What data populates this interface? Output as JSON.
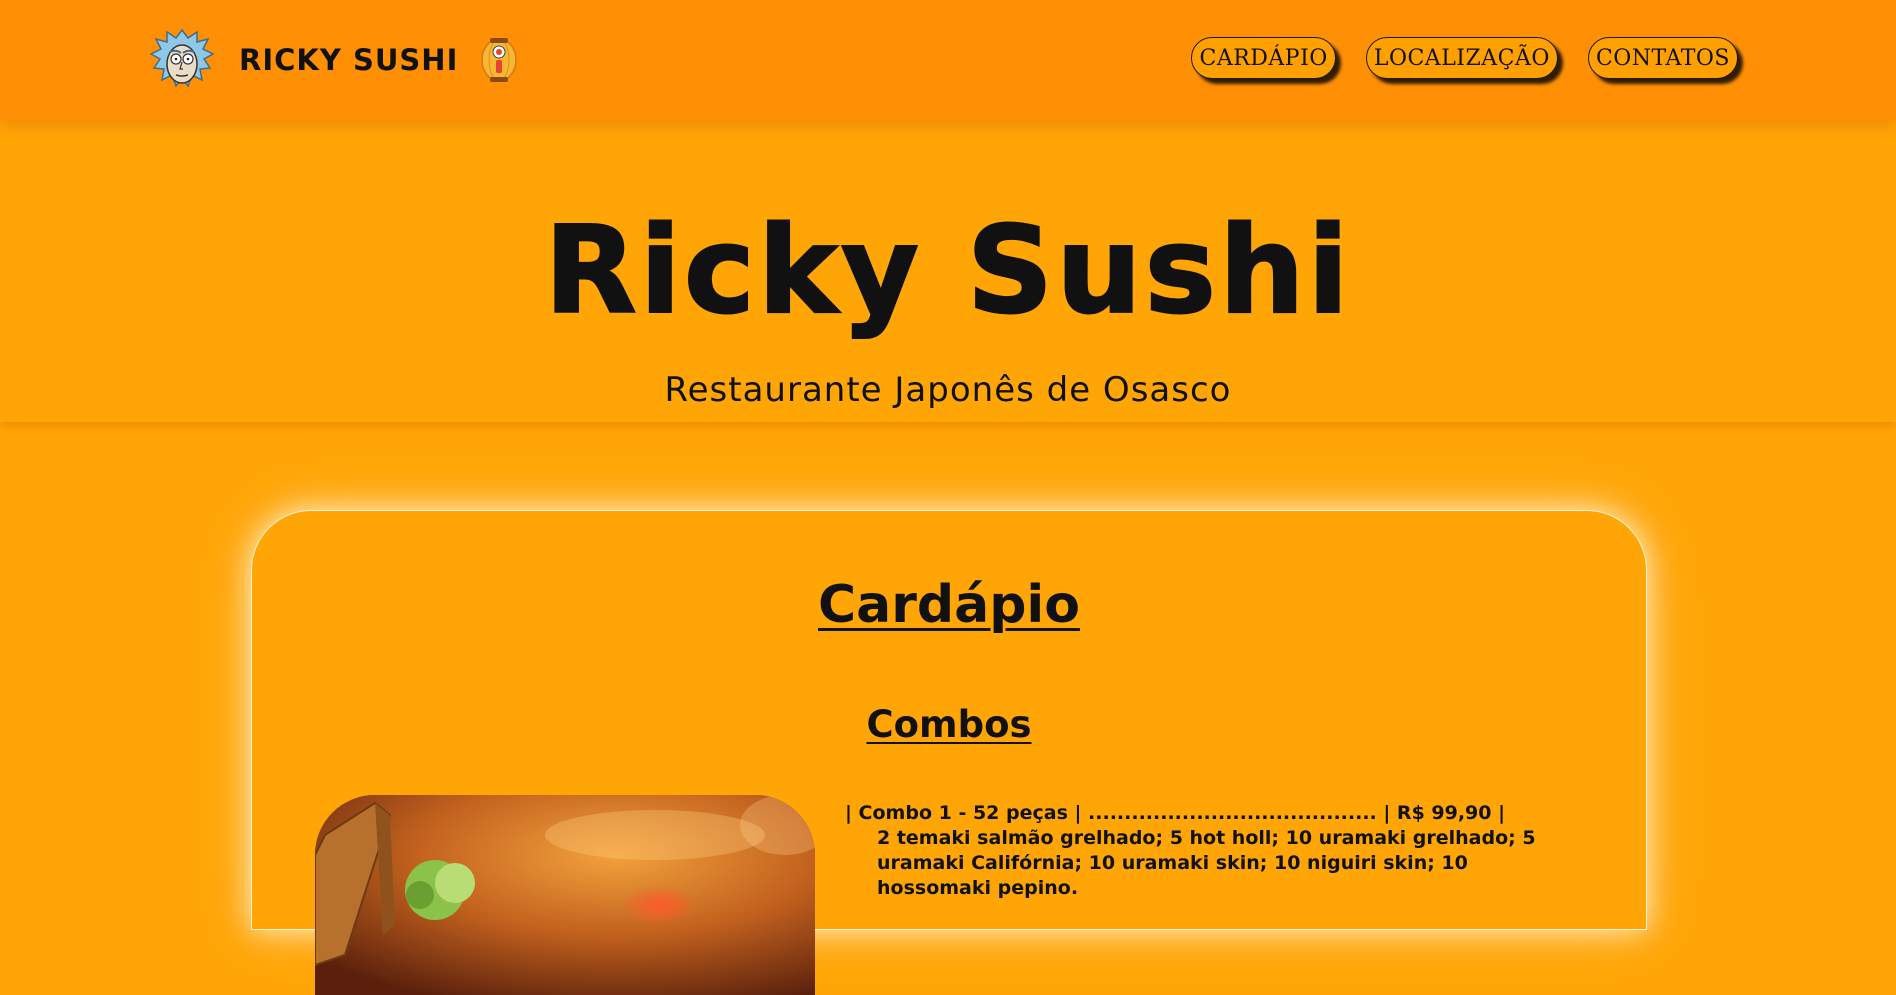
{
  "colors": {
    "navbar_bg": "#ff8f05",
    "page_bg": "#ffa506",
    "text": "#111111",
    "card_glow": "#fff2d4"
  },
  "navbar": {
    "logo_icon": "rick-face-icon",
    "brand_name": "RICKY SUSHI",
    "brand_icon": "sushi-lantern-icon",
    "links": [
      {
        "label": "CARDÁPIO"
      },
      {
        "label": "LOCALIZAÇÃO"
      },
      {
        "label": "CONTATOS"
      }
    ]
  },
  "hero": {
    "title": "Ricky Sushi",
    "subtitle": "Restaurante Japonês de Osasco"
  },
  "menu": {
    "title": "Cardápio",
    "sections": [
      {
        "title": "Combos",
        "image_icon": "sushi-platter-photo",
        "items": [
          {
            "line": "| Combo 1 - 52 peças | ........................................ | R$ 99,90 |",
            "description": "2 temaki salmão grelhado; 5 hot holl; 10 uramaki grelhado; 5 uramaki Califórnia; 10 uramaki skin; 10 niguiri skin; 10 hossomaki pepino."
          }
        ]
      }
    ]
  }
}
